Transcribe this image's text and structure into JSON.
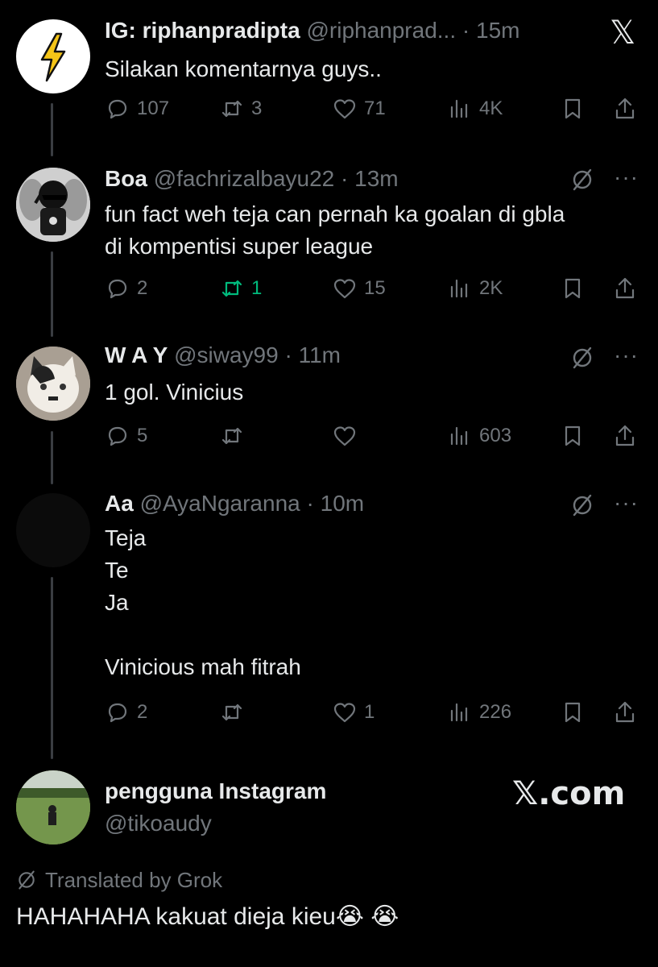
{
  "tweets": [
    {
      "name": "IG: riphanpradipta",
      "handle": "@riphanprad...",
      "time": "15m",
      "text": "Silakan komentarnya guys..",
      "reply_count": "107",
      "retweet_count": "3",
      "like_count": "71",
      "view_count": "4K"
    },
    {
      "name": "Boa",
      "handle": "@fachrizalbayu22",
      "time": "13m",
      "text": "fun fact weh teja can pernah ka goalan di gbla\ndi kompentisi super league",
      "reply_count": "2",
      "retweet_count": "1",
      "like_count": "15",
      "view_count": "2K"
    },
    {
      "name": "W A Y",
      "handle": "@siway99",
      "time": "11m",
      "text": "1 gol. Vinicius",
      "reply_count": "5",
      "retweet_count": "",
      "like_count": "",
      "view_count": "603"
    },
    {
      "name": "Aa",
      "handle": "@AyaNgaranna",
      "time": "10m",
      "text": "Teja\nTe\nJa\n\nVinicious mah fitrah",
      "reply_count": "2",
      "retweet_count": "",
      "like_count": "1",
      "view_count": "226"
    }
  ],
  "dot_separator": " · ",
  "x_logo": "𝕏",
  "footer_user": {
    "name": "pengguna Instagram",
    "handle": "@tikoaudy",
    "brand": "𝕏.com"
  },
  "translated_label": "Translated by Grok",
  "final_text": "HAHAHAHA kakuat dieja kieu😭 😭",
  "colors": {
    "background": "#000000",
    "text": "#e7e9ea",
    "muted": "#71767b",
    "retweet_active": "#00ba7c",
    "thread_line": "#3a3d42"
  }
}
